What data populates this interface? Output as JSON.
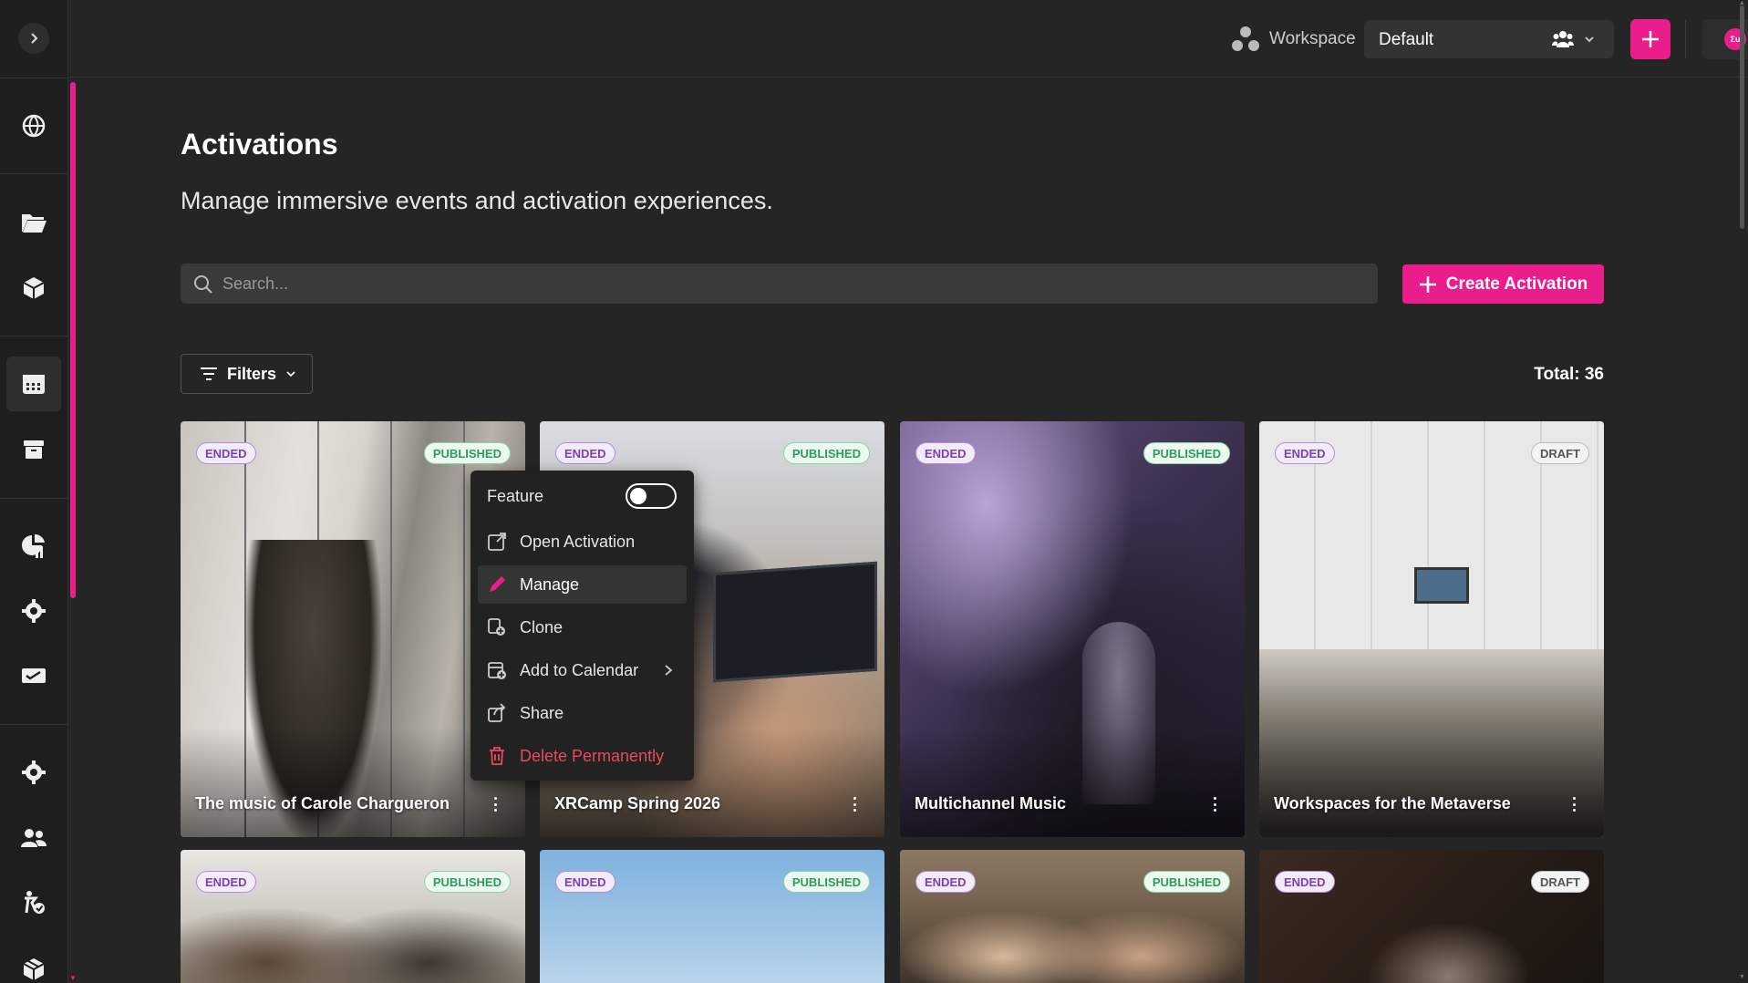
{
  "sidebar": {
    "toggle_icon": "chevron-right-icon",
    "items": [
      {
        "name": "globe-icon"
      },
      {
        "name": "folder-icon"
      },
      {
        "name": "cube-icon"
      },
      {
        "name": "calendar-icon",
        "active": true
      },
      {
        "name": "archive-icon"
      },
      {
        "name": "analytics-icon"
      },
      {
        "name": "gear-icon"
      },
      {
        "name": "ticket-icon"
      },
      {
        "name": "settings-icon"
      },
      {
        "name": "users-icon"
      },
      {
        "name": "accessibility-icon"
      },
      {
        "name": "package-icon"
      }
    ],
    "accent_color": "#e91e8c"
  },
  "topbar": {
    "workspace_label": "Workspace",
    "workspace_value": "Default",
    "avatar_text": "Ʃu"
  },
  "page": {
    "title": "Activations",
    "subtitle": "Manage immersive events and activation experiences."
  },
  "search": {
    "placeholder": "Search..."
  },
  "toolbar": {
    "create_label": "Create Activation",
    "filters_label": "Filters",
    "total_label": "Total: 36"
  },
  "cards": [
    {
      "status": "ENDED",
      "publish": "PUBLISHED",
      "title": "The music of Carole Chargueron"
    },
    {
      "status": "ENDED",
      "publish": "PUBLISHED",
      "title": "XRCamp Spring 2026"
    },
    {
      "status": "ENDED",
      "publish": "PUBLISHED",
      "title": "Multichannel Music"
    },
    {
      "status": "ENDED",
      "publish": "DRAFT",
      "title": "Workspaces for the Metaverse"
    },
    {
      "status": "ENDED",
      "publish": "PUBLISHED",
      "title": ""
    },
    {
      "status": "ENDED",
      "publish": "PUBLISHED",
      "title": ""
    },
    {
      "status": "ENDED",
      "publish": "PUBLISHED",
      "title": ""
    },
    {
      "status": "ENDED",
      "publish": "DRAFT",
      "title": ""
    }
  ],
  "context_menu": {
    "feature_label": "Feature",
    "feature_on": false,
    "items": [
      {
        "label": "Open Activation",
        "icon": "external-link-icon"
      },
      {
        "label": "Manage",
        "icon": "pencil-icon"
      },
      {
        "label": "Clone",
        "icon": "clone-icon"
      },
      {
        "label": "Add to Calendar",
        "icon": "calendar-add-icon"
      },
      {
        "label": "Share",
        "icon": "share-icon"
      },
      {
        "label": "Delete Permanently",
        "icon": "trash-icon"
      }
    ]
  },
  "colors": {
    "accent": "#e91e8c",
    "background": "#252525",
    "danger": "#e84a5f"
  }
}
